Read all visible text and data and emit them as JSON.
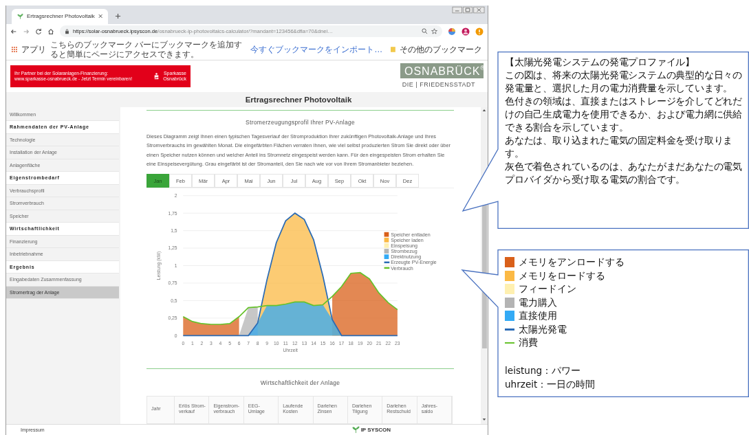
{
  "browser": {
    "tab_title": "Ertragsrechner Photovoltaik",
    "url_host": "https://solar-osnabrueck.ipsyscon.de",
    "url_path": "/osnabrueck-ip-photovoltaics-calculator/?mandant=123456&dfla=70&dnei…",
    "bookmarks": {
      "apps": "アプリ",
      "hint": "こちらのブックマーク バーにブックマークを追加すると簡単にページにアクセスできます。",
      "import_link": "今すぐブックマークをインポート…",
      "other": "その他のブックマーク"
    }
  },
  "page": {
    "banner": {
      "line_1": "Ihr Partner bei der Solaranlagen-Finanzierung:",
      "line_2": "www.sparkasse-osnabrueck.de - Jetzt Termin vereinbaren!",
      "brand_1": "Sparkasse",
      "brand_2": "Osnabrück"
    },
    "logo": {
      "name": "OSNABRÜCK",
      "mark": "®",
      "tagline": "DIE | FRIEDENSSTADT"
    },
    "title": "Ertragsrechner Photovoltaik",
    "sidebar": [
      {
        "label": "Willkommen",
        "kind": "link",
        "selected": false
      },
      {
        "label": "Rahmendaten der PV-Anlage",
        "kind": "heading",
        "selected": false
      },
      {
        "label": "Technologie",
        "kind": "link",
        "selected": false
      },
      {
        "label": "Installation der Anlage",
        "kind": "link",
        "selected": false
      },
      {
        "label": "Anlagenfläche",
        "kind": "link",
        "selected": false
      },
      {
        "label": "Eigenstrombedarf",
        "kind": "heading",
        "selected": false
      },
      {
        "label": "Verbrauchsprofil",
        "kind": "link",
        "selected": false
      },
      {
        "label": "Stromverbrauch",
        "kind": "link",
        "selected": false
      },
      {
        "label": "Speicher",
        "kind": "link",
        "selected": false
      },
      {
        "label": "Wirtschaftlichkeit",
        "kind": "heading",
        "selected": false
      },
      {
        "label": "Finanzierung",
        "kind": "link",
        "selected": false
      },
      {
        "label": "Inbetriebnahme",
        "kind": "link",
        "selected": false
      },
      {
        "label": "Ergebnis",
        "kind": "heading",
        "selected": false
      },
      {
        "label": "Eingabedaten Zusammenfassung",
        "kind": "link",
        "selected": false
      },
      {
        "label": "Stromertrag der Anlage",
        "kind": "link",
        "selected": true
      }
    ],
    "section_title": "Stromerzeugungsprofil Ihrer PV-Anlage",
    "description": "Dieses Diagramm zeigt Ihnen einen typischen Tagesverlauf der Stromproduktion Ihrer zukünftigen Photovoltaik-Anlage und Ihres Stromverbrauchs im gewählten Monat. Die eingefärbten Flächen verraten Ihnen, wie viel selbst produzierten Strom Sie direkt oder über einen Speicher nutzen können und welcher Anteil ins Stromnetz eingespeist werden kann. Für den eingespeisten Strom erhalten Sie eine Einspeisevergütung. Grau eingefärbt ist der Stromanteil, den Sie nach wie vor von Ihrem Stromanbieter beziehen.",
    "months": [
      {
        "label": "Jan",
        "selected": true
      },
      {
        "label": "Feb",
        "selected": false
      },
      {
        "label": "Mär",
        "selected": false
      },
      {
        "label": "Apr",
        "selected": false
      },
      {
        "label": "Mai",
        "selected": false
      },
      {
        "label": "Jun",
        "selected": false
      },
      {
        "label": "Jul",
        "selected": false
      },
      {
        "label": "Aug",
        "selected": false
      },
      {
        "label": "Sep",
        "selected": false
      },
      {
        "label": "Okt",
        "selected": false
      },
      {
        "label": "Nov",
        "selected": false
      },
      {
        "label": "Dez",
        "selected": false
      }
    ],
    "chart": {
      "chart_data": {
        "type": "area",
        "stacked": false,
        "xlabel": "Uhrzeit",
        "ylabel": "Leistung (kW)",
        "x": [
          0,
          1,
          2,
          3,
          4,
          5,
          6,
          7,
          8,
          9,
          10,
          11,
          12,
          13,
          14,
          15,
          16,
          17,
          18,
          19,
          20,
          21,
          22,
          23
        ],
        "ylim": [
          0,
          2
        ],
        "yticks": [
          {
            "value": 0,
            "label": "0"
          },
          {
            "value": 0.25,
            "label": "0,25"
          },
          {
            "value": 0.5,
            "label": "0,5"
          },
          {
            "value": 0.75,
            "label": "0,75"
          },
          {
            "value": 1,
            "label": "1"
          },
          {
            "value": 1.25,
            "label": "1,25"
          },
          {
            "value": 1.5,
            "label": "1,5"
          },
          {
            "value": 1.75,
            "label": "1,75"
          },
          {
            "value": 2,
            "label": "2"
          }
        ],
        "grid": true,
        "legend": true,
        "series": [
          {
            "name": "Speicher entladen",
            "type": "area",
            "color": "#d9601a",
            "values": [
              0.27,
              0.2,
              0.17,
              0.16,
              0.16,
              0.17,
              0.27,
              null,
              null,
              null,
              null,
              null,
              null,
              null,
              null,
              null,
              0.56,
              0.7,
              0.89,
              0.9,
              0.81,
              0.61,
              0.47,
              0.37
            ]
          },
          {
            "name": "Speicher laden",
            "type": "area",
            "color": "#fbb944",
            "values": [
              null,
              null,
              null,
              null,
              null,
              null,
              null,
              0,
              0.18,
              0.8,
              1.33,
              1.64,
              1.75,
              1.66,
              1.37,
              0.85,
              0.23,
              0,
              null,
              null,
              null,
              null,
              null,
              null
            ]
          },
          {
            "name": "Einspeisung",
            "type": "area",
            "color": "#fff0b0",
            "values": [
              null,
              null,
              null,
              null,
              null,
              null,
              null,
              null,
              null,
              null,
              null,
              null,
              null,
              null,
              null,
              null,
              null,
              null,
              null,
              null,
              null,
              null,
              null,
              null
            ]
          },
          {
            "name": "Strombezug",
            "type": "area",
            "color": "#b4b4b4",
            "values": [
              null,
              null,
              null,
              null,
              null,
              null,
              0,
              0.4,
              0.41,
              null,
              null,
              null,
              null,
              null,
              null,
              null,
              null,
              null,
              null,
              null,
              null,
              null,
              null,
              null
            ]
          },
          {
            "name": "Direktnutzung",
            "type": "area",
            "color": "#33aaf5",
            "values": [
              null,
              null,
              null,
              null,
              null,
              null,
              null,
              0,
              0.18,
              0.43,
              0.43,
              0.45,
              0.48,
              0.48,
              0.43,
              0.44,
              0.23,
              0,
              null,
              null,
              null,
              null,
              null,
              null
            ]
          },
          {
            "name": "Erzeugte PV-Energie",
            "type": "line",
            "color": "#2a6bb5",
            "values": [
              0,
              0,
              0,
              0,
              0,
              0,
              0,
              0,
              0.18,
              0.8,
              1.33,
              1.64,
              1.75,
              1.66,
              1.37,
              0.85,
              0.23,
              0,
              0,
              0,
              0,
              0,
              0,
              0
            ]
          },
          {
            "name": "Verbrauch",
            "type": "line",
            "color": "#66c22b",
            "values": [
              0.27,
              0.2,
              0.17,
              0.16,
              0.16,
              0.17,
              0.27,
              0.4,
              0.41,
              0.43,
              0.43,
              0.45,
              0.48,
              0.48,
              0.43,
              0.44,
              0.56,
              0.7,
              0.89,
              0.9,
              0.81,
              0.61,
              0.47,
              0.37
            ]
          }
        ]
      }
    },
    "economy_title": "Wirtschaftlichkeit der Anlage",
    "table_columns": [
      "Jahr",
      "Erlös Strom-\nverkauf",
      "Eigenstrom-\nverbrauch",
      "EEG-\nUmlage",
      "Laufende\nKosten",
      "Darlehen\nZinsen",
      "Darlehen\nTilgung",
      "Darlehen\nRestschuld",
      "Jahres-\nsaldo"
    ],
    "footer": {
      "link": "Impressum",
      "brand": "IP SYSCON"
    }
  },
  "annotations": {
    "explanation": {
      "title": "【太陽光発電システムの発電プロファイル】",
      "paragraphs": [
        "この図は、将来の太陽光発電システムの典型的な日々の発電量と、選択した月の電力消費量を示しています。",
        "色付きの領域は、直接またはストレージを介してどれだけの自己生成電力を使用できるか、および電力網に供給できる割合を示しています。",
        "あなたは、取り込まれた電気の固定料金を受け取ります。",
        "灰色で着色されているのは、あなたがまだあなたの電気プロバイダから受け取る電気の割合です。"
      ]
    },
    "legend": {
      "items": [
        {
          "label": "メモリをアンロードする",
          "kind": "swatch",
          "color": "#d9601a"
        },
        {
          "label": "メモリをロードする",
          "kind": "swatch",
          "color": "#fbb944"
        },
        {
          "label": "フィードイン",
          "kind": "swatch",
          "color": "#fff0b0"
        },
        {
          "label": "電力購入",
          "kind": "swatch",
          "color": "#b4b4b4"
        },
        {
          "label": "直接使用",
          "kind": "swatch",
          "color": "#33aaf5"
        },
        {
          "label": "太陽光発電",
          "kind": "line",
          "color": "#2a6bb5"
        },
        {
          "label": "消費",
          "kind": "line",
          "color": "#66c22b"
        }
      ],
      "glossary": [
        "leistung：パワー",
        "uhrzeit：一日の時間"
      ]
    }
  }
}
